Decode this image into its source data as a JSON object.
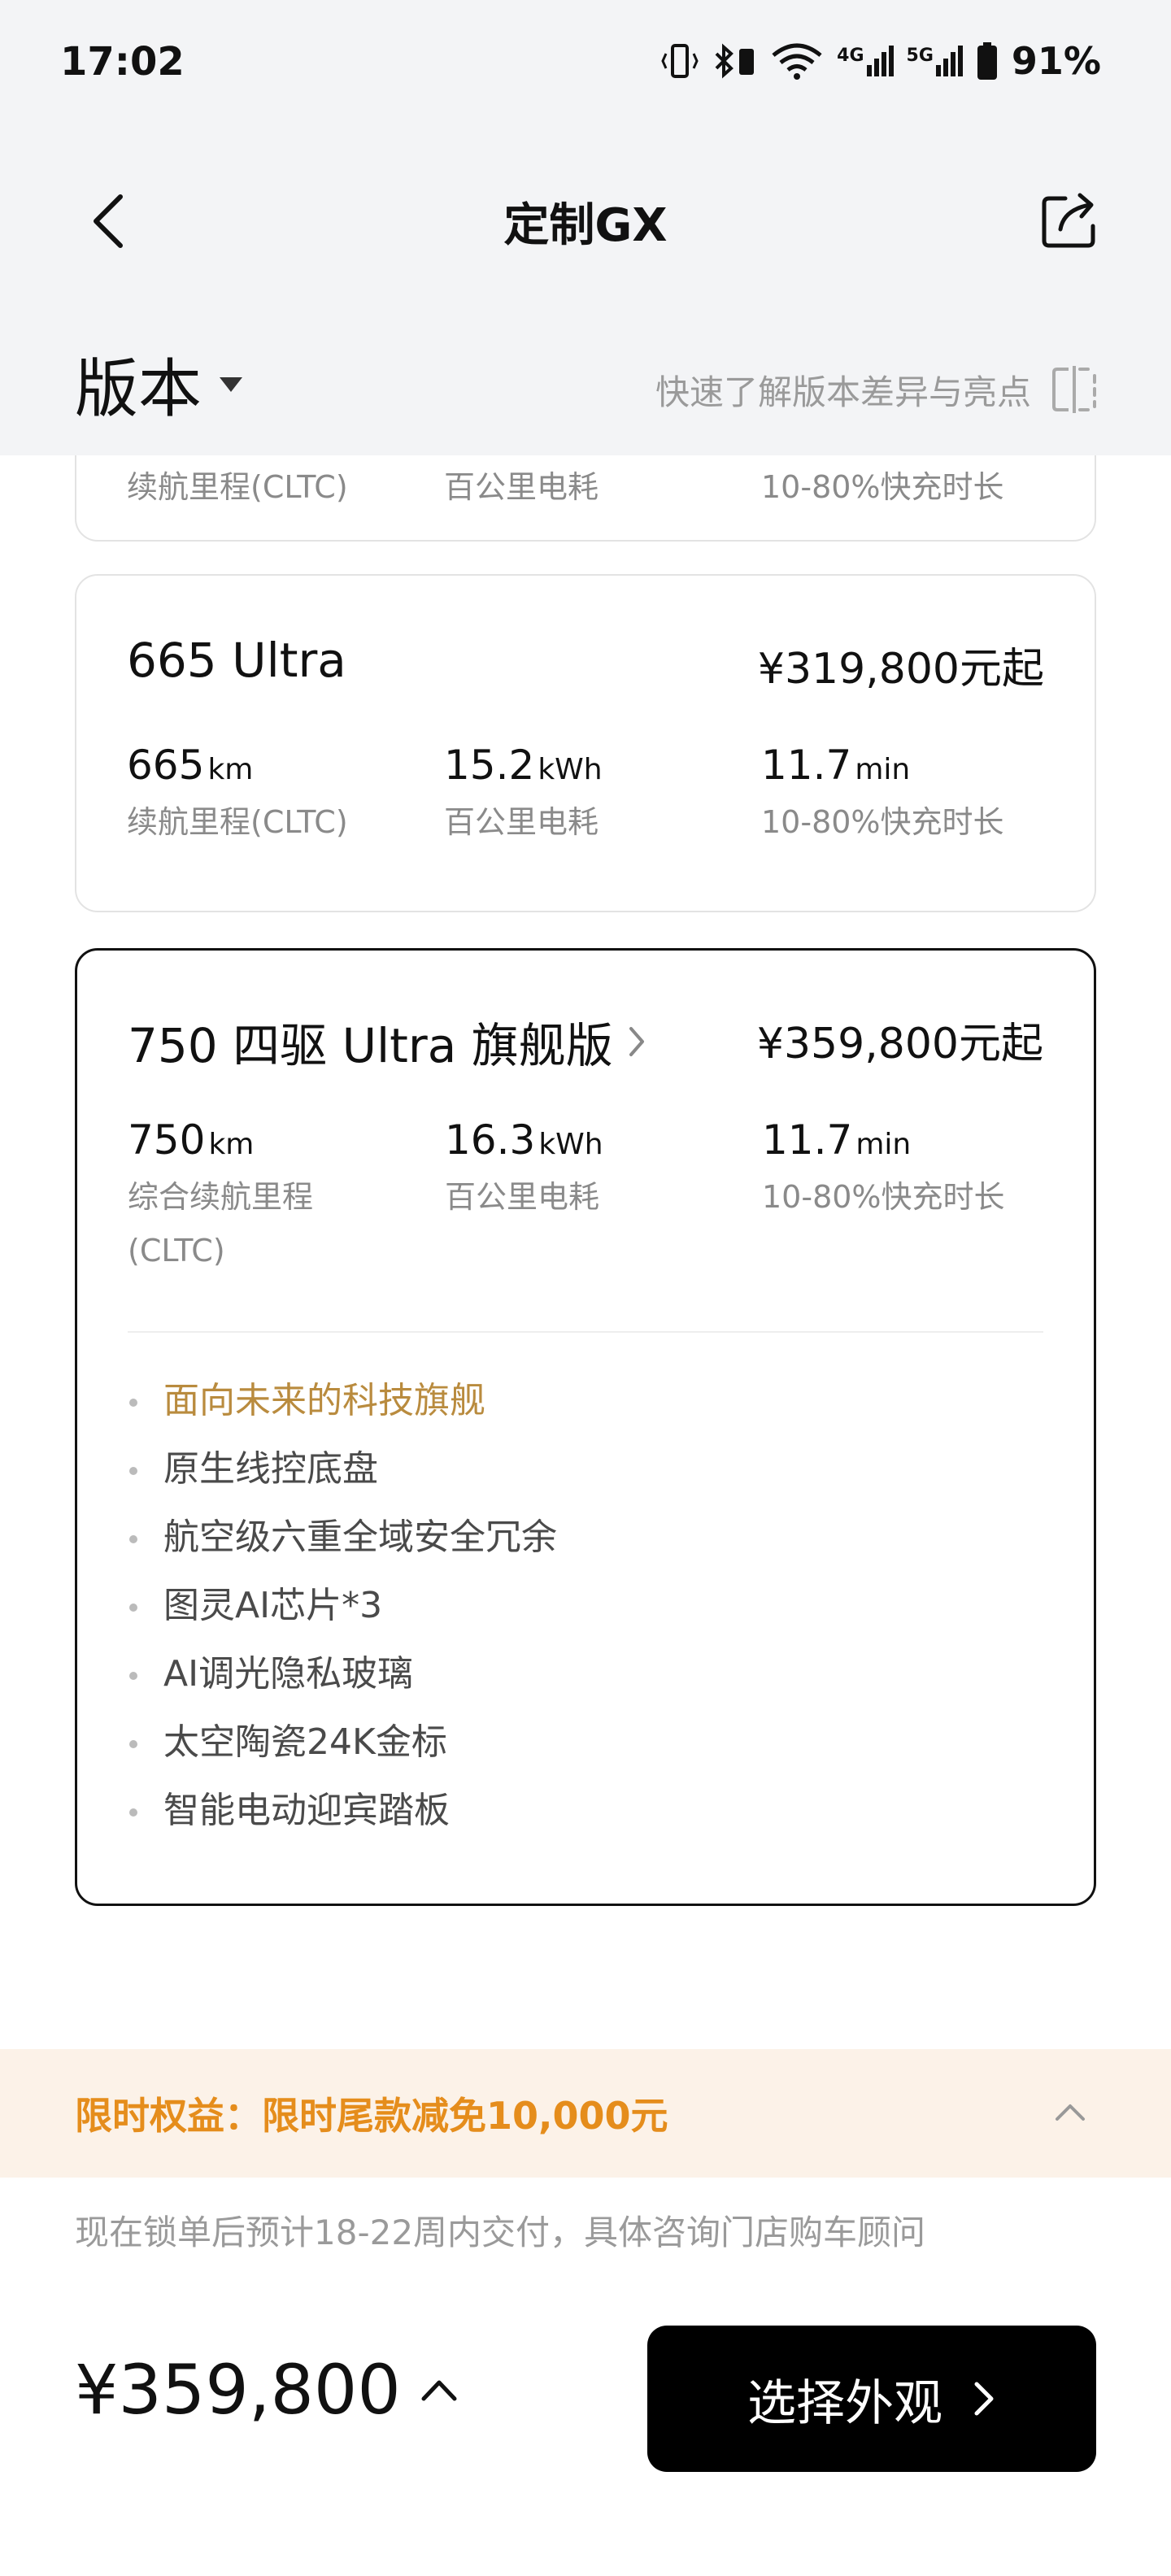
{
  "status": {
    "time": "17:02",
    "battery": "91%",
    "net1": "4G",
    "net2": "5G"
  },
  "nav": {
    "title": "定制GX"
  },
  "version": {
    "label": "版本",
    "compare_text": "快速了解版本差异与亮点"
  },
  "cards": [
    {
      "name": "",
      "price": "",
      "specs": [
        {
          "value": "",
          "unit": "",
          "label": "续航里程(CLTC)"
        },
        {
          "value": "",
          "unit": "",
          "label": "百公里电耗"
        },
        {
          "value": "",
          "unit": "",
          "label": "10-80%快充时长"
        }
      ]
    },
    {
      "name": "665 Ultra",
      "price": "¥319,800元起",
      "specs": [
        {
          "value": "665",
          "unit": "km",
          "label": "续航里程(CLTC)"
        },
        {
          "value": "15.2",
          "unit": "kWh",
          "label": "百公里电耗"
        },
        {
          "value": "11.7",
          "unit": "min",
          "label": "10-80%快充时长"
        }
      ]
    },
    {
      "name": "750 四驱 Ultra 旗舰版",
      "price": "¥359,800元起",
      "specs": [
        {
          "value": "750",
          "unit": "km",
          "label": "综合续航里程 (CLTC)"
        },
        {
          "value": "16.3",
          "unit": "kWh",
          "label": "百公里电耗"
        },
        {
          "value": "11.7",
          "unit": "min",
          "label": "10-80%快充时长"
        }
      ],
      "features": [
        "面向未来的科技旗舰",
        "原生线控底盘",
        "航空级六重全域安全冗余",
        "图灵AI芯片*3",
        "AI调光隐私玻璃",
        "太空陶瓷24K金标",
        "智能电动迎宾踏板"
      ]
    }
  ],
  "promo": {
    "text": "限时权益：限时尾款减免10,000元"
  },
  "delivery": "现在锁单后预计18-22周内交付，具体咨询门店购车顾问",
  "footer": {
    "total": "¥359,800",
    "cta_label": "选择外观"
  },
  "colors": {
    "accent_orange": "#e58d1c",
    "feature_gold": "#b98b3e",
    "promo_bg": "#fcf2e8",
    "header_bg": "#f3f4f6"
  }
}
